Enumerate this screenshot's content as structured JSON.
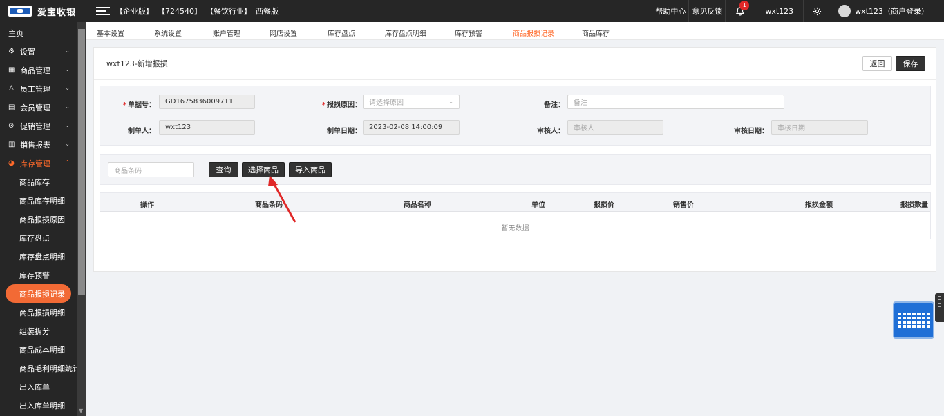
{
  "app": {
    "name": "爱宝收银"
  },
  "topbar": {
    "tags": [
      "【企业版】",
      "【724540】",
      "【餐饮行业】",
      "西餐版"
    ],
    "help": "帮助中心",
    "feedback": "意见反馈",
    "notification_count": "1",
    "user": "wxt123",
    "account": "wxt123（商户登录）"
  },
  "sidebar": {
    "home": "主页",
    "groups": [
      {
        "label": "设置",
        "icon": "gear-icon"
      },
      {
        "label": "商品管理",
        "icon": "grid-icon"
      },
      {
        "label": "员工管理",
        "icon": "user-icon"
      },
      {
        "label": "会员管理",
        "icon": "card-icon"
      },
      {
        "label": "促销管理",
        "icon": "check-circle-icon"
      },
      {
        "label": "销售报表",
        "icon": "bar-chart-icon"
      }
    ],
    "open_group": "库存管理",
    "sub_items": [
      "商品库存",
      "商品库存明细",
      "商品报损原因",
      "库存盘点",
      "库存盘点明细",
      "库存预警",
      "商品报损记录",
      "商品报损明细",
      "组装拆分",
      "商品成本明细",
      "商品毛利明细统计",
      "出入库单",
      "出入库单明细"
    ],
    "active_sub": "商品报损记录"
  },
  "tabs": [
    "基本设置",
    "系统设置",
    "账户管理",
    "网店设置",
    "库存盘点",
    "库存盘点明细",
    "库存预警",
    "商品报损记录",
    "商品库存"
  ],
  "active_tab": "商品报损记录",
  "page": {
    "title": "wxt123-新增报损",
    "back": "返回",
    "save": "保存"
  },
  "form": {
    "doc_no_label": "单据号：",
    "doc_no": "GD1675836009711",
    "reason_label": "报损原因：",
    "reason_placeholder": "请选择原因",
    "remark_label": "备注：",
    "remark_placeholder": "备注",
    "creator_label": "制单人：",
    "creator": "wxt123",
    "date_label": "制单日期：",
    "date": "2023-02-08 14:00:09",
    "auditor_label": "审核人：",
    "auditor_placeholder": "审核人",
    "audit_date_label": "审核日期：",
    "audit_date_placeholder": "审核日期"
  },
  "query": {
    "barcode_placeholder": "商品条码",
    "search": "查询",
    "select_goods": "选择商品",
    "import_goods": "导入商品"
  },
  "table": {
    "columns": [
      "操作",
      "商品条码",
      "商品名称",
      "单位",
      "报损价",
      "销售价",
      "报损金额",
      "报损数量"
    ],
    "empty": "暂无数据"
  },
  "colors": {
    "accent": "#f26a35",
    "dark": "#262626",
    "annotation": "#e02828"
  }
}
